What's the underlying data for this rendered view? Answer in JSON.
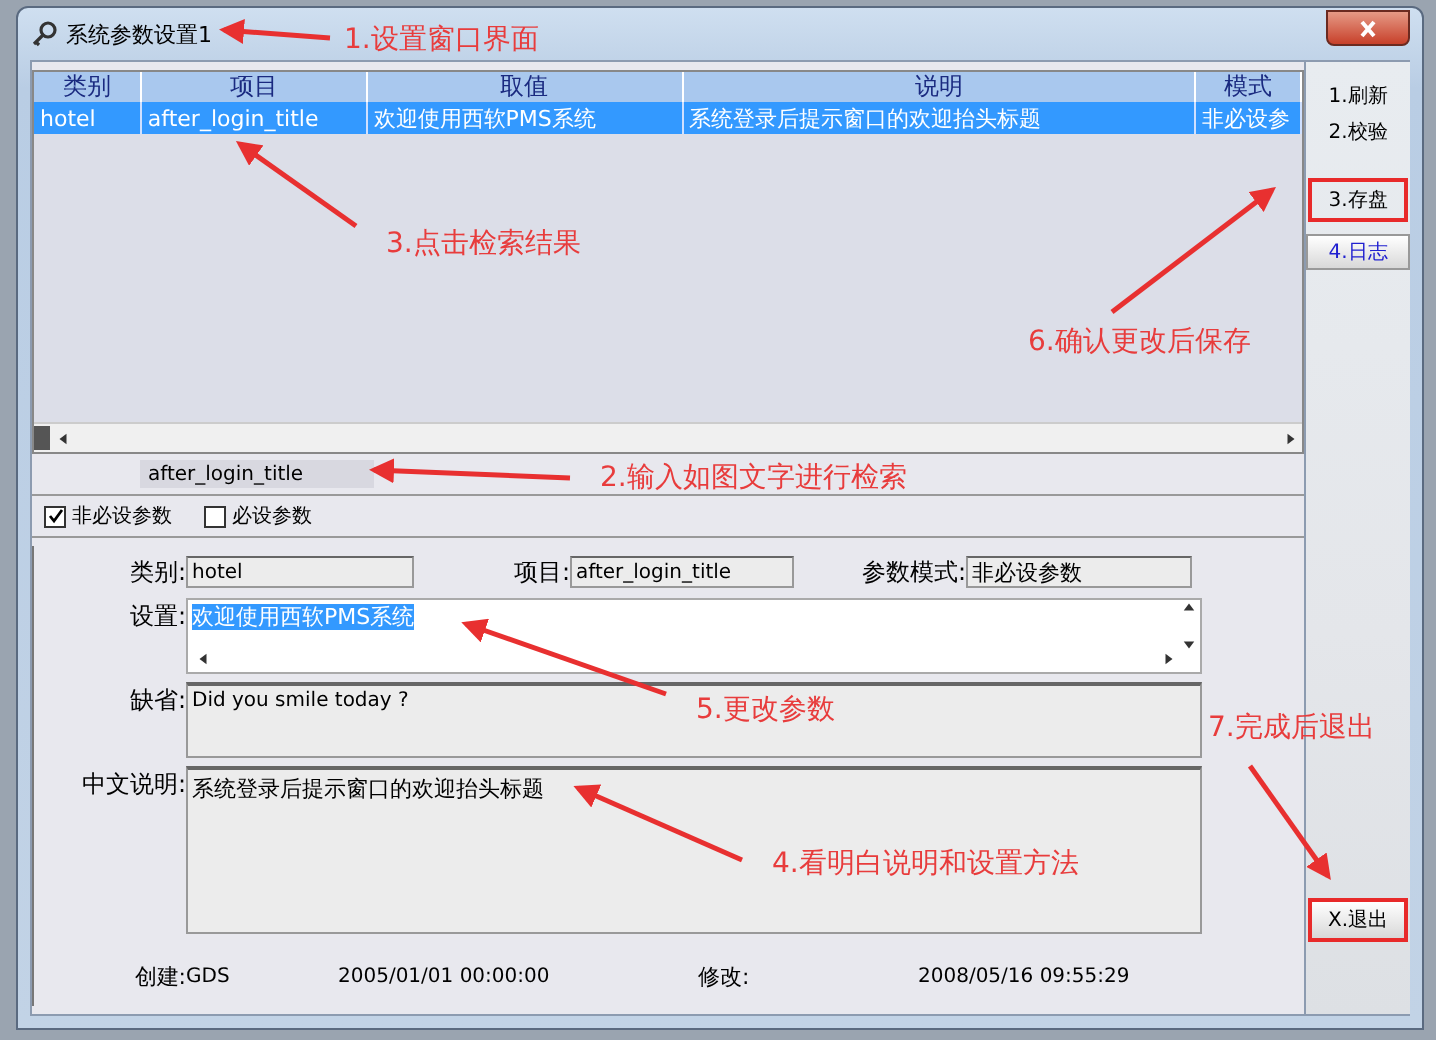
{
  "window": {
    "title": "系统参数设置1"
  },
  "table": {
    "columns": [
      "类别",
      "项目",
      "取值",
      "说明",
      "模式"
    ],
    "rows": [
      {
        "selected": true,
        "cells": [
          "hotel",
          "after_login_title",
          "欢迎使用西软PMS系统",
          "系统登录后提示窗口的欢迎抬头标题",
          "非必设参"
        ]
      }
    ]
  },
  "search": {
    "value": "after_login_title"
  },
  "filters": [
    {
      "label": "非必设参数",
      "checked": true
    },
    {
      "label": "必设参数",
      "checked": false
    }
  ],
  "form": {
    "category_label": "类别:",
    "category": "hotel",
    "item_label": "项目:",
    "item": "after_login_title",
    "mode_label": "参数模式:",
    "mode": "非必设参数",
    "setting_label": "设置:",
    "setting": "欢迎使用西软PMS系统",
    "default_label": "缺省:",
    "default": "Did you smile today ?",
    "description_label": "中文说明:",
    "description": "系统登录后提示窗口的欢迎抬头标题",
    "created_label": "创建:",
    "created_by": "GDS",
    "created_at": "2005/01/01 00:00:00",
    "modified_label": "修改:",
    "modified_at": "2008/05/16 09:55:29"
  },
  "side_buttons": [
    {
      "label": "1.刷新",
      "kind": "flat",
      "highlighted": false
    },
    {
      "label": "2.校验",
      "kind": "flat",
      "highlighted": false
    },
    {
      "label": "3.存盘",
      "kind": "flat",
      "highlighted": true
    },
    {
      "label": "4.日志",
      "kind": "raised",
      "highlighted": false
    },
    {
      "label": "X.退出",
      "kind": "raised",
      "highlighted": true
    }
  ],
  "annotations": [
    {
      "text": "1.设置窗口界面"
    },
    {
      "text": "3.点击检索结果"
    },
    {
      "text": "6.确认更改后保存"
    },
    {
      "text": "2.输入如图文字进行检索"
    },
    {
      "text": "5.更改参数"
    },
    {
      "text": "7.完成后退出"
    },
    {
      "text": "4.看明白说明和设置方法"
    }
  ]
}
